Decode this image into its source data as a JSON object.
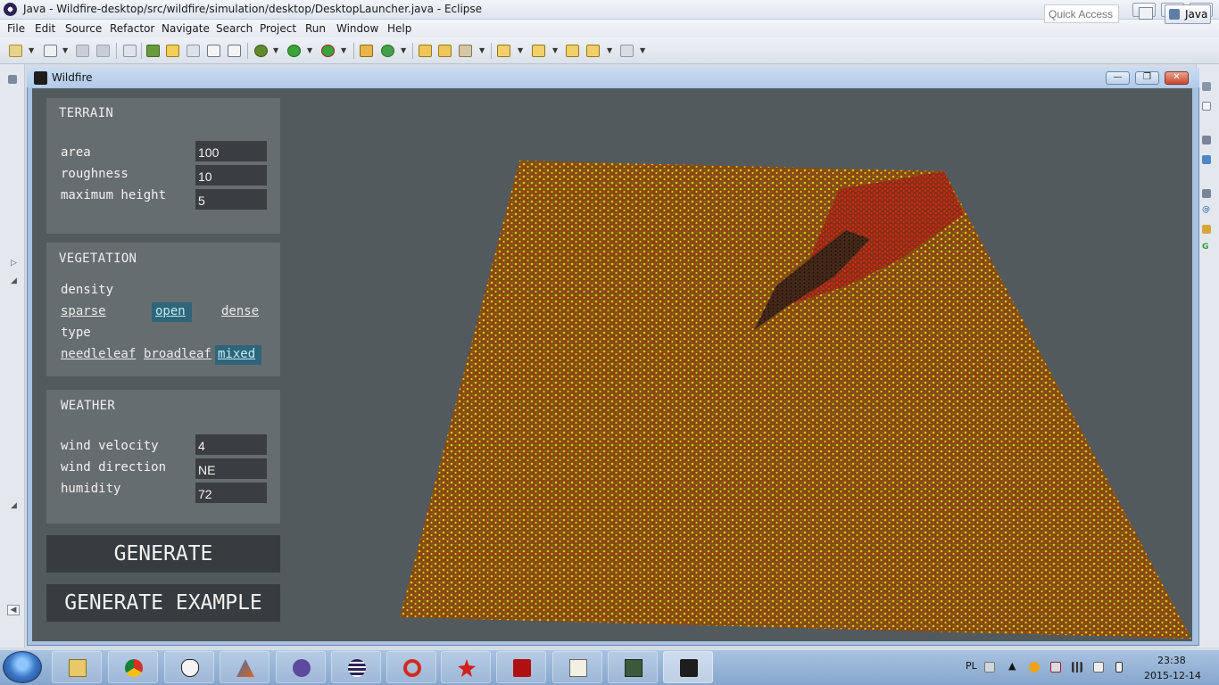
{
  "eclipse": {
    "title": "Java - Wildfire-desktop/src/wildfire/simulation/desktop/DesktopLauncher.java - Eclipse",
    "window_buttons": {
      "minimize": "—",
      "maximize": "❐",
      "close": "✕"
    },
    "menu": [
      "File",
      "Edit",
      "Source",
      "Refactor",
      "Navigate",
      "Search",
      "Project",
      "Run",
      "Window",
      "Help"
    ],
    "quick_access_placeholder": "Quick Access",
    "perspective": "Java"
  },
  "wildfire": {
    "title": "Wildfire",
    "window_buttons": {
      "minimize": "—",
      "maximize": "❐",
      "close": "✕"
    },
    "terrain": {
      "title": "TERRAIN",
      "area_label": "area",
      "area_value": "100",
      "roughness_label": "roughness",
      "roughness_value": "10",
      "max_height_label": "maximum height",
      "max_height_value": "5"
    },
    "vegetation": {
      "title": "VEGETATION",
      "density_label": "density",
      "density_options": [
        "sparse",
        "open",
        "dense"
      ],
      "density_selected": "open",
      "type_label": "type",
      "type_options": [
        "needleleaf",
        "broadleaf",
        "mixed"
      ],
      "type_selected": "mixed"
    },
    "weather": {
      "title": "WEATHER",
      "wind_velocity_label": "wind velocity",
      "wind_velocity_value": "4",
      "wind_direction_label": "wind direction",
      "wind_direction_value": "NE",
      "humidity_label": "humidity",
      "humidity_value": "72"
    },
    "buttons": {
      "generate": "GENERATE",
      "generate_example": "GENERATE EXAMPLE"
    },
    "colors": {
      "background": "#535a5e",
      "panel": "#666d70",
      "ground": "#8a4a12",
      "tree_yellow": "#d8c21a",
      "tree_green": "#3f8f1e",
      "fire": "#c8261a",
      "burnt": "#2a1d17"
    }
  },
  "taskbar": {
    "apps": [
      "explorer-icon",
      "chrome-icon",
      "app-icon",
      "matlab-icon",
      "app-icon",
      "eclipse-icon",
      "opera-icon",
      "app-icon",
      "acrobat-icon",
      "tex-icon",
      "app-icon",
      "wildfire-icon"
    ],
    "language": "PL",
    "time": "23:38",
    "date": "2015-12-14"
  }
}
